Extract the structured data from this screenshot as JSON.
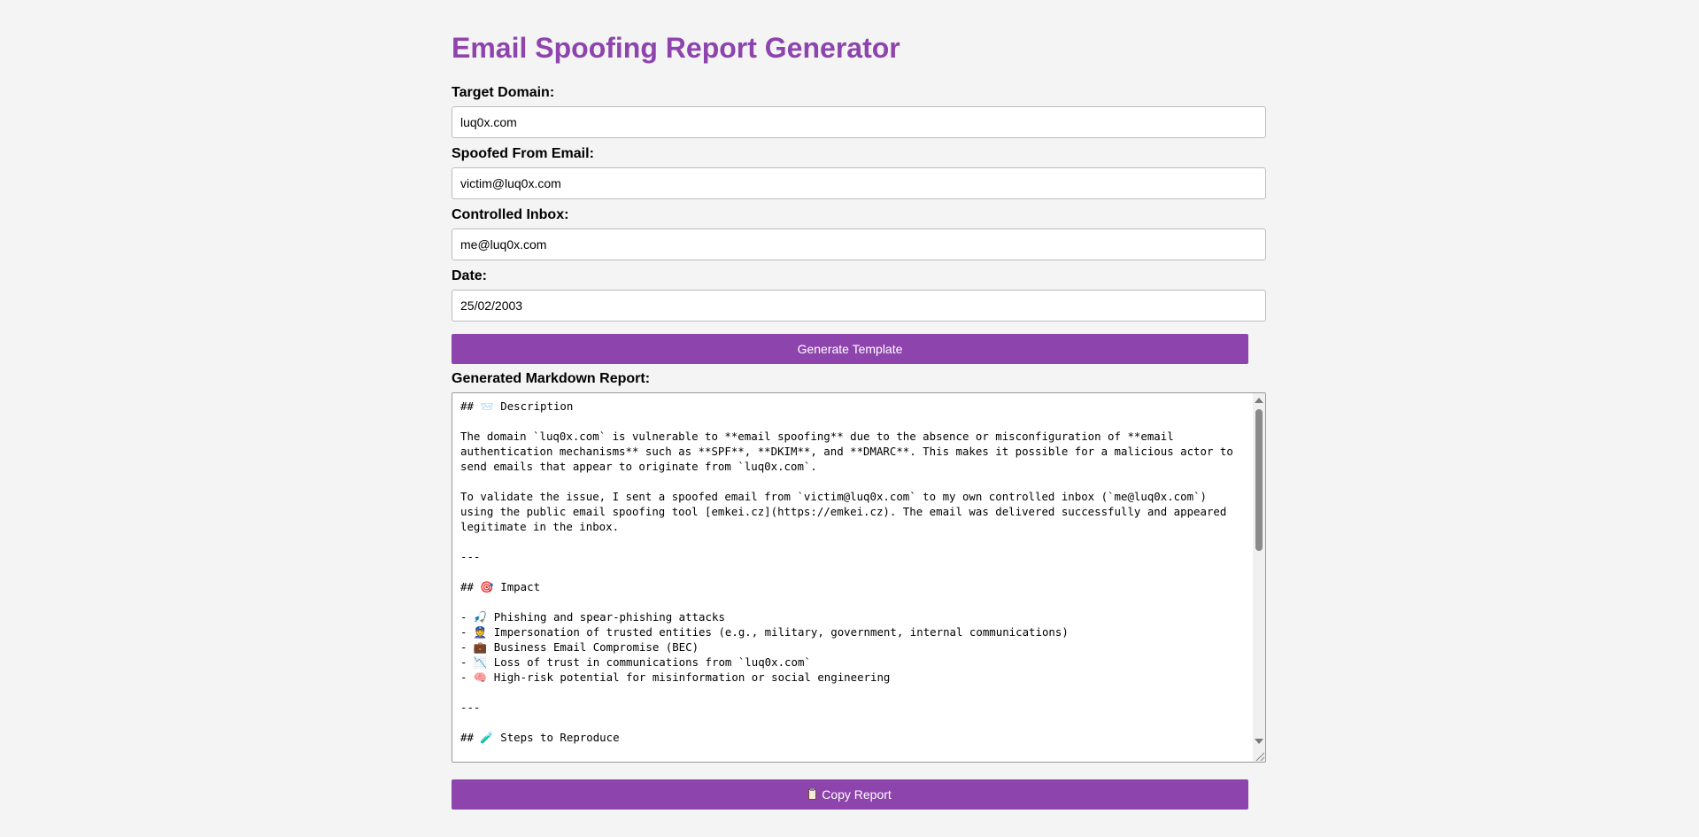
{
  "page_title": "Email Spoofing Report Generator",
  "form": {
    "target_domain": {
      "label": "Target Domain:",
      "value": "luq0x.com"
    },
    "spoofed_from": {
      "label": "Spoofed From Email:",
      "value": "victim@luq0x.com"
    },
    "controlled_inbox": {
      "label": "Controlled Inbox:",
      "value": "me@luq0x.com"
    },
    "date": {
      "label": "Date:",
      "value": "25/02/2003"
    },
    "generate_button": "Generate Template"
  },
  "report": {
    "label": "Generated Markdown Report:",
    "content": "## 📨 Description\n\nThe domain `luq0x.com` is vulnerable to **email spoofing** due to the absence or misconfiguration of **email authentication mechanisms** such as **SPF**, **DKIM**, and **DMARC**. This makes it possible for a malicious actor to send emails that appear to originate from `luq0x.com`.\n\nTo validate the issue, I sent a spoofed email from `victim@luq0x.com` to my own controlled inbox (`me@luq0x.com`) using the public email spoofing tool [emkei.cz](https://emkei.cz). The email was delivered successfully and appeared legitimate in the inbox.\n\n---\n\n## 🎯 Impact\n\n- 🎣 Phishing and spear-phishing attacks\n- 👮 Impersonation of trusted entities (e.g., military, government, internal communications)\n- 💼 Business Email Compromise (BEC)\n- 📉 Loss of trust in communications from `luq0x.com`\n- 🧠 High-risk potential for misinformation or social engineering\n\n---\n\n## 🧪 Steps to Reproduce",
    "copy_button": "Copy Report",
    "copy_icon": "clipboard-icon"
  },
  "colors": {
    "accent": "#8e44ad",
    "background": "#f4f4f4"
  }
}
